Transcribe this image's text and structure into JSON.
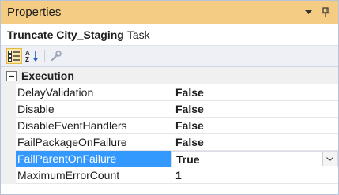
{
  "window": {
    "title": "Properties",
    "dropdown_icon": "triangle-down-icon",
    "pin_icon": "pushpin-icon"
  },
  "object": {
    "name": "Truncate City_Staging",
    "type": "Task"
  },
  "toolbar": {
    "buttons": [
      "categorized-icon",
      "alphabetical-icon",
      "property-pages-icon"
    ]
  },
  "grid": {
    "category": {
      "label": "Execution",
      "expander": "−"
    },
    "rows": [
      {
        "name": "DelayValidation",
        "value": "False"
      },
      {
        "name": "Disable",
        "value": "False"
      },
      {
        "name": "DisableEventHandlers",
        "value": "False"
      },
      {
        "name": "FailPackageOnFailure",
        "value": "False"
      },
      {
        "name": "FailParentOnFailure",
        "value": "True",
        "selected": true
      },
      {
        "name": "MaximumErrorCount",
        "value": "1"
      }
    ]
  },
  "colors": {
    "title_bg": "#f5cc84",
    "selection": "#3399ff",
    "gutter": "#f0f0f0"
  }
}
